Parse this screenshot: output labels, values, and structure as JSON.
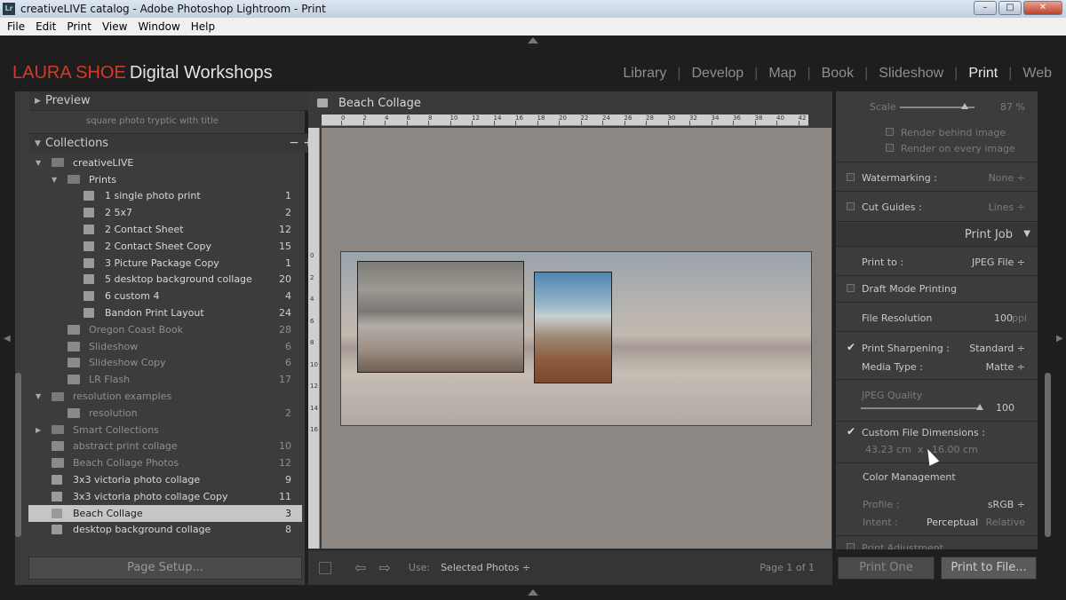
{
  "window": {
    "title": "creativeLIVE catalog - Adobe Photoshop Lightroom - Print",
    "app_icon": "Lr"
  },
  "menu": [
    "File",
    "Edit",
    "Print",
    "View",
    "Window",
    "Help"
  ],
  "brand": {
    "part1": "LAURA SHOE",
    "part2": "Digital Workshops"
  },
  "modules": [
    "Library",
    "Develop",
    "Map",
    "Book",
    "Slideshow",
    "Print",
    "Web"
  ],
  "active_module": "Print",
  "left": {
    "preview_label": "Preview",
    "template_item": "square photo tryptic with title",
    "collections_label": "Collections",
    "collections_tools": "− +",
    "page_setup": "Page Setup..."
  },
  "collections": [
    {
      "name": "creativeLIVE",
      "count": "",
      "level": 0,
      "icon": "folder",
      "expanded": true
    },
    {
      "name": "Prints",
      "count": "",
      "level": 1,
      "icon": "folder",
      "expanded": true
    },
    {
      "name": "1 single photo print",
      "count": "1",
      "level": 2,
      "icon": "printer"
    },
    {
      "name": "2 5x7",
      "count": "2",
      "level": 2,
      "icon": "printer"
    },
    {
      "name": "2 Contact Sheet",
      "count": "12",
      "level": 2,
      "icon": "printer"
    },
    {
      "name": "2 Contact Sheet Copy",
      "count": "15",
      "level": 2,
      "icon": "printer"
    },
    {
      "name": "3 Picture Package Copy",
      "count": "1",
      "level": 2,
      "icon": "printer"
    },
    {
      "name": "5 desktop background collage",
      "count": "20",
      "level": 2,
      "icon": "printer"
    },
    {
      "name": "6 custom 4",
      "count": "4",
      "level": 2,
      "icon": "printer"
    },
    {
      "name": "Bandon Print Layout",
      "count": "24",
      "level": 2,
      "icon": "printer"
    },
    {
      "name": "Oregon Coast Book",
      "count": "28",
      "level": 1,
      "icon": "book",
      "dim": true
    },
    {
      "name": "Slideshow",
      "count": "6",
      "level": 1,
      "icon": "slideshow",
      "dim": true
    },
    {
      "name": "Slideshow Copy",
      "count": "6",
      "level": 1,
      "icon": "slideshow",
      "dim": true
    },
    {
      "name": "LR Flash",
      "count": "17",
      "level": 1,
      "icon": "web",
      "dim": true
    },
    {
      "name": "resolution examples",
      "count": "",
      "level": 0,
      "icon": "folder",
      "expanded": true,
      "dim": true
    },
    {
      "name": "resolution",
      "count": "2",
      "level": 1,
      "icon": "collection",
      "dim": true
    },
    {
      "name": "Smart Collections",
      "count": "",
      "level": 0,
      "icon": "folder",
      "dim": true,
      "collapsed": true
    },
    {
      "name": "abstract print collage",
      "count": "10",
      "level": 0,
      "icon": "collection",
      "dim": true
    },
    {
      "name": "Beach Collage Photos",
      "count": "12",
      "level": 0,
      "icon": "collection",
      "dim": true
    },
    {
      "name": "3x3 victoria photo collage",
      "count": "9",
      "level": 0,
      "icon": "printer"
    },
    {
      "name": "3x3 victoria photo collage Copy",
      "count": "11",
      "level": 0,
      "icon": "printer"
    },
    {
      "name": "Beach Collage",
      "count": "3",
      "level": 0,
      "icon": "printer",
      "selected": true
    },
    {
      "name": "desktop background collage",
      "count": "8",
      "level": 0,
      "icon": "printer"
    }
  ],
  "center": {
    "title": "Beach Collage",
    "ruler_ticks": [
      "0",
      "2",
      "4",
      "6",
      "8",
      "10",
      "12",
      "14",
      "16",
      "18",
      "20",
      "22",
      "24",
      "26",
      "28",
      "30",
      "32",
      "34",
      "36",
      "38",
      "40",
      "42"
    ],
    "ruler_v_ticks": [
      "0",
      "2",
      "4",
      "6",
      "8",
      "10",
      "12",
      "14",
      "16"
    ],
    "use_label": "Use:",
    "use_value": "Selected Photos",
    "page_info": "Page 1 of 1"
  },
  "right": {
    "scale_label": "Scale",
    "scale_value": "87 %",
    "scale_fraction": 0.87,
    "render_behind": "Render behind image",
    "render_every": "Render on every image",
    "watermarking_label": "Watermarking :",
    "watermarking_value": "None ÷",
    "cut_guides_label": "Cut Guides :",
    "cut_guides_value": "Lines ÷",
    "print_job_header": "Print Job",
    "print_to_label": "Print to :",
    "print_to_value": "JPEG File ÷",
    "draft_mode": "Draft Mode Printing",
    "file_resolution_label": "File Resolution",
    "file_resolution_value": "100",
    "file_resolution_unit": "ppi",
    "print_sharpening_label": "Print Sharpening :",
    "print_sharpening_value": "Standard ÷",
    "media_type_label": "Media Type :",
    "media_type_value": "Matte ÷",
    "jpeg_quality_label": "JPEG Quality",
    "jpeg_quality_value": "100",
    "jpeg_quality_fraction": 1.0,
    "custom_dims_label": "Custom File Dimensions :",
    "dims_width": "43.23 cm",
    "dims_x": "x",
    "dims_height": "16.00 cm",
    "color_mgmt_label": "Color Management",
    "profile_label": "Profile :",
    "profile_value": "sRGB ÷",
    "intent_label": "Intent :",
    "intent_perceptual": "Perceptual",
    "intent_relative": "Relative",
    "print_adjustment": "Print Adjustment",
    "print_one": "Print One",
    "print_to_file": "Print to File..."
  }
}
